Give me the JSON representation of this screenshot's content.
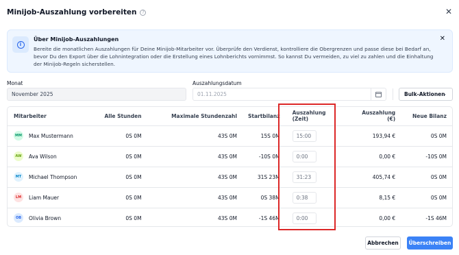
{
  "dialog": {
    "title": "Minijob-Auszahlung vorbereiten",
    "help_icon": "help-circle-icon",
    "close_icon": "close-icon"
  },
  "info": {
    "icon": "info-icon",
    "title": "Über Minijob-Auszahlungen",
    "text": "Bereite die monatlichen Auszahlungen für Deine Minijob-Mitarbeiter vor. Überprüfe den Verdienst, kontrolliere die Obergrenzen und passe diese bei Bedarf an, bevor Du den Export über die Lohnintegration oder die Erstellung eines Lohnberichts vornimmst. So kannst Du vermeiden, zu viel zu zahlen und die Einhaltung der Minijob-Regeln sicherstellen."
  },
  "month": {
    "label": "Monat",
    "value": "November 2025"
  },
  "payout_date": {
    "label": "Auszahlungsdatum",
    "placeholder": "01.11.2025",
    "icon": "calendar-icon"
  },
  "bulk_actions": {
    "label": "Bulk-Aktionen",
    "icon": "chevron-down-icon"
  },
  "table": {
    "columns": [
      "Mitarbeiter",
      "Alle Stunden",
      "Maximale Stundenzahl",
      "Startbilanz",
      "Auszahlung (Zeit)",
      "Auszahlung (€)",
      "Neue Bilanz"
    ],
    "rows": [
      {
        "initials": "MM",
        "name": "Max Mustermann",
        "all_hours": "0S 0M",
        "max_hours": "43S 0M",
        "start_balance": "15S 0M",
        "payout_time": "15:00",
        "payout_eur": "193,94 €",
        "new_balance": "0S 0M",
        "avatar_bg": "#d1fae5",
        "avatar_fg": "#059669"
      },
      {
        "initials": "AW",
        "name": "Ava Wilson",
        "all_hours": "0S 0M",
        "max_hours": "43S 0M",
        "start_balance": "-10S 0M",
        "payout_time": "0:00",
        "payout_eur": "0,00 €",
        "new_balance": "-10S 0M",
        "avatar_bg": "#ecfccb",
        "avatar_fg": "#65a30d"
      },
      {
        "initials": "MT",
        "name": "Michael Thompson",
        "all_hours": "0S 0M",
        "max_hours": "43S 0M",
        "start_balance": "31S 23M",
        "payout_time": "31:23",
        "payout_eur": "405,74 €",
        "new_balance": "0S 0M",
        "avatar_bg": "#e0f2fe",
        "avatar_fg": "#0284c7"
      },
      {
        "initials": "LM",
        "name": "Liam Mauer",
        "all_hours": "0S 0M",
        "max_hours": "43S 0M",
        "start_balance": "0S 38M",
        "payout_time": "0:38",
        "payout_eur": "8,15 €",
        "new_balance": "0S 0M",
        "avatar_bg": "#fee2e2",
        "avatar_fg": "#dc2626"
      },
      {
        "initials": "OB",
        "name": "Olivia Brown",
        "all_hours": "0S 0M",
        "max_hours": "43S 0M",
        "start_balance": "-1S 46M",
        "payout_time": "0:00",
        "payout_eur": "0,00 €",
        "new_balance": "-1S 46M",
        "avatar_bg": "#dbeafe",
        "avatar_fg": "#2563eb"
      }
    ]
  },
  "footer": {
    "cancel_label": "Abbrechen",
    "submit_label": "Überschreiben"
  },
  "colors": {
    "primary": "#3b82f6",
    "highlight": "#dc2626",
    "info_bg": "#eff6ff"
  }
}
